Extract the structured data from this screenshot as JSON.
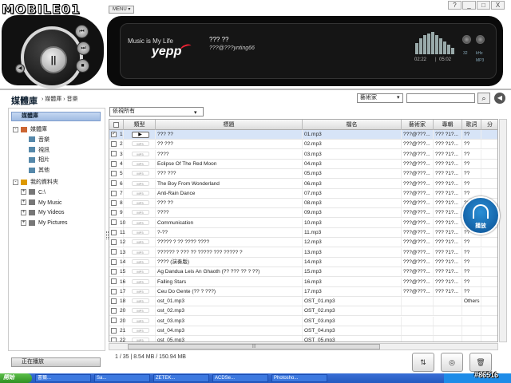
{
  "brand": {
    "logo_text": "MOBILE01"
  },
  "menu": {
    "label": "MENU ▾"
  },
  "window_controls": {
    "help": "?",
    "minimize": "_",
    "maximize": "□",
    "close": "X"
  },
  "player": {
    "slogan": "Music is My Life",
    "brand": "yepp",
    "track_title": "??? ??",
    "track_artist": "???@???ynting66",
    "time_current": "02:22",
    "time_total": "05:02",
    "bitrate": "32",
    "khz_label": "kHz",
    "format": "MP3",
    "buttons": {
      "play_pause": "||",
      "prev": "⏮",
      "next": "⏭",
      "stop": "■"
    }
  },
  "library": {
    "title": "媒體庫",
    "breadcrumb": "› 媒體庫 › 音樂",
    "filter_value": "藝術家",
    "search_placeholder": "",
    "view_value": "依視所有"
  },
  "sidebar": {
    "header": "媒體庫",
    "tree": [
      {
        "label": "媒體庫",
        "level": 0,
        "expander": "-"
      },
      {
        "label": "音樂",
        "level": 1,
        "expander": ""
      },
      {
        "label": "視訊",
        "level": 1,
        "expander": ""
      },
      {
        "label": "相片",
        "level": 1,
        "expander": ""
      },
      {
        "label": "其他",
        "level": 1,
        "expander": ""
      },
      {
        "label": "我的資料夾",
        "level": 0,
        "expander": "-"
      },
      {
        "label": "C:\\",
        "level": 1,
        "expander": "+"
      },
      {
        "label": "My Music",
        "level": 1,
        "expander": "+"
      },
      {
        "label": "My Videos",
        "level": 1,
        "expander": "+"
      },
      {
        "label": "My Pictures",
        "level": 1,
        "expander": "+"
      }
    ],
    "now_playing": "正在播放"
  },
  "table": {
    "columns": [
      "",
      "類型",
      "標題",
      "檔名",
      "藝術家",
      "專輯",
      "歌詞",
      "分"
    ],
    "rows": [
      {
        "n": "1",
        "type": "▶",
        "title": "??? ??",
        "file": "01.mp3",
        "artist": "???@???...",
        "album": "??? ?1?...",
        "lyrics": "??",
        "checked": true
      },
      {
        "n": "2",
        "type": "MP3",
        "title": "?? ???",
        "file": "02.mp3",
        "artist": "???@???...",
        "album": "??? ?1?...",
        "lyrics": "??",
        "checked": false
      },
      {
        "n": "3",
        "type": "MP3",
        "title": "????",
        "file": "03.mp3",
        "artist": "???@???...",
        "album": "??? ?1?...",
        "lyrics": "??",
        "checked": false
      },
      {
        "n": "4",
        "type": "MP3",
        "title": "Eclipse Of The Red Moon",
        "file": "04.mp3",
        "artist": "???@???...",
        "album": "??? ?1?...",
        "lyrics": "??",
        "checked": false
      },
      {
        "n": "5",
        "type": "MP3",
        "title": "??? ???",
        "file": "05.mp3",
        "artist": "???@???...",
        "album": "??? ?1?...",
        "lyrics": "??",
        "checked": false
      },
      {
        "n": "6",
        "type": "MP3",
        "title": "The Boy From Wonderland",
        "file": "06.mp3",
        "artist": "???@???...",
        "album": "??? ?1?...",
        "lyrics": "??",
        "checked": false
      },
      {
        "n": "7",
        "type": "MP3",
        "title": "Anti-Rain Dance",
        "file": "07.mp3",
        "artist": "???@???...",
        "album": "??? ?1?...",
        "lyrics": "??",
        "checked": false
      },
      {
        "n": "8",
        "type": "MP3",
        "title": "??? ??",
        "file": "08.mp3",
        "artist": "???@???...",
        "album": "??? ?1?...",
        "lyrics": "??",
        "checked": false
      },
      {
        "n": "9",
        "type": "MP3",
        "title": "????",
        "file": "09.mp3",
        "artist": "???@???...",
        "album": "??? ?1?...",
        "lyrics": "??",
        "checked": false
      },
      {
        "n": "10",
        "type": "MP3",
        "title": "Communication",
        "file": "10.mp3",
        "artist": "???@???...",
        "album": "??? ?1?...",
        "lyrics": "??",
        "checked": false
      },
      {
        "n": "11",
        "type": "MP3",
        "title": "?-??",
        "file": "11.mp3",
        "artist": "???@???...",
        "album": "??? ?1?...",
        "lyrics": "??",
        "checked": false
      },
      {
        "n": "12",
        "type": "MP3",
        "title": "????? ? ?? ???? ????",
        "file": "12.mp3",
        "artist": "???@???...",
        "album": "??? ?1?...",
        "lyrics": "??",
        "checked": false
      },
      {
        "n": "13",
        "type": "MP3",
        "title": "?????? ? ??? ?? ????? ??? ????? ?",
        "file": "13.mp3",
        "artist": "???@???...",
        "album": "??? ?1?...",
        "lyrics": "??",
        "checked": false
      },
      {
        "n": "14",
        "type": "MP3",
        "title": "???? (演奏版)",
        "file": "14.mp3",
        "artist": "???@???...",
        "album": "??? ?1?...",
        "lyrics": "??",
        "checked": false
      },
      {
        "n": "15",
        "type": "MP3",
        "title": "Ag Dandua Leis An Ghaoth (?? ??? ?? ? ??)",
        "file": "15.mp3",
        "artist": "???@???...",
        "album": "??? ?1?...",
        "lyrics": "??",
        "checked": false
      },
      {
        "n": "16",
        "type": "MP3",
        "title": "Falling Stars",
        "file": "16.mp3",
        "artist": "???@???...",
        "album": "??? ?1?...",
        "lyrics": "??",
        "checked": false
      },
      {
        "n": "17",
        "type": "MP3",
        "title": "Ceu Do Gente (?? ? ???)",
        "file": "17.mp3",
        "artist": "???@???...",
        "album": "??? ?1?...",
        "lyrics": "??",
        "checked": false
      },
      {
        "n": "18",
        "type": "MP3",
        "title": "ost_01.mp3",
        "file": "OST_01.mp3",
        "artist": "",
        "album": "",
        "lyrics": "Others",
        "checked": false
      },
      {
        "n": "20",
        "type": "MP3",
        "title": "ost_02.mp3",
        "file": "OST_02.mp3",
        "artist": "",
        "album": "",
        "lyrics": "",
        "checked": false
      },
      {
        "n": "20",
        "type": "MP3",
        "title": "ost_03.mp3",
        "file": "OST_03.mp3",
        "artist": "",
        "album": "",
        "lyrics": "",
        "checked": false
      },
      {
        "n": "21",
        "type": "MP3",
        "title": "ost_04.mp3",
        "file": "OST_04.mp3",
        "artist": "",
        "album": "",
        "lyrics": "",
        "checked": false
      },
      {
        "n": "22",
        "type": "MP3",
        "title": "ost_05.mp3",
        "file": "OST_05.mp3",
        "artist": "",
        "album": "",
        "lyrics": "",
        "checked": false
      }
    ]
  },
  "play_badge": {
    "label": "播放"
  },
  "status": {
    "text": "1 / 35  |  8.54 MB / 150.94 MB"
  },
  "actions": {
    "transfer": "⇅",
    "burn": "◎",
    "delete": "🗑"
  },
  "taskbar": {
    "start": "開始",
    "tasks": [
      "書籤...",
      "Sa...",
      "ZETEK...",
      "ACDSe...",
      "Photosho..."
    ]
  },
  "watermark": "#86516",
  "colors": {
    "accent": "#245ac0",
    "selected_row": "#d7e4f7",
    "player_bg": "#0a0a0a",
    "badge": "#1f7fce"
  }
}
